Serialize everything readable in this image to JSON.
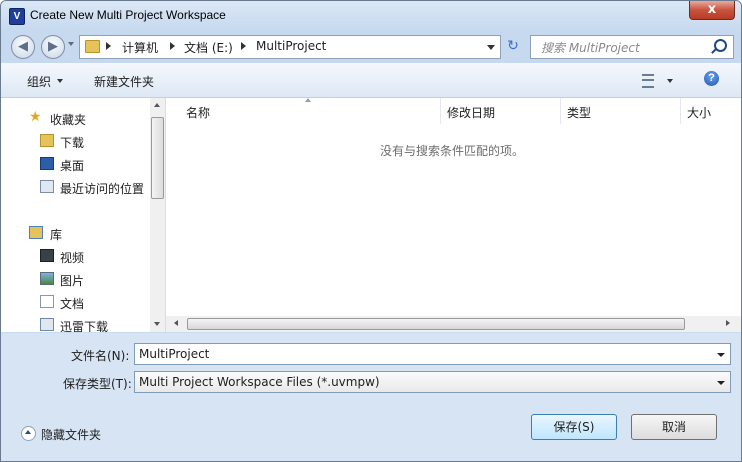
{
  "window": {
    "title": "Create New Multi Project Workspace",
    "close_glyph": "x"
  },
  "address": {
    "crumbs": [
      "计算机",
      "文档 (E:)",
      "MultiProject"
    ]
  },
  "search": {
    "placeholder": "搜索 MultiProject"
  },
  "toolbar": {
    "organize": "组织",
    "new_folder": "新建文件夹"
  },
  "sidebar": {
    "items": [
      {
        "label": "收藏夹",
        "icon": "star-icon"
      },
      {
        "label": "下载",
        "icon": "download-folder-icon"
      },
      {
        "label": "桌面",
        "icon": "desktop-icon"
      },
      {
        "label": "最近访问的位置",
        "icon": "recent-places-icon"
      },
      {
        "label": "库",
        "icon": "library-icon"
      },
      {
        "label": "视频",
        "icon": "video-icon"
      },
      {
        "label": "图片",
        "icon": "picture-icon"
      },
      {
        "label": "文档",
        "icon": "document-icon"
      },
      {
        "label": "迅雷下载",
        "icon": "download-icon"
      }
    ]
  },
  "columns": [
    "名称",
    "修改日期",
    "类型",
    "大小"
  ],
  "empty_message": "没有与搜索条件匹配的项。",
  "form": {
    "filename_label": "文件名(N):",
    "filename_value": "MultiProject",
    "filetype_label": "保存类型(T):",
    "filetype_value": "Multi Project Workspace Files (*.uvmpw)"
  },
  "buttons": {
    "save": "保存(S)",
    "cancel": "取消",
    "hide_folders": "隐藏文件夹"
  },
  "colors": {
    "accent": "#3c7fb1",
    "frame": "#c6d9ee",
    "bottom_panel": "#d6e4f3"
  }
}
